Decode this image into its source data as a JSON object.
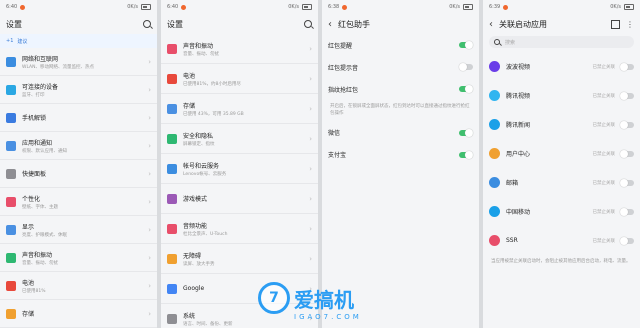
{
  "watermark": {
    "logo_char": "7",
    "text": "爱搞机",
    "url": "IGAO7.COM"
  },
  "panel1": {
    "time": "6:40",
    "net": "0K/s",
    "title": "设置",
    "suggestion": "建议",
    "items": [
      {
        "title": "网络和互联网",
        "sub": "WLAN、移动网络、流量监控、热点",
        "color": "#3b8de0"
      },
      {
        "title": "可连接的设备",
        "sub": "蓝牙、打印",
        "color": "#2aa7e3"
      },
      {
        "title": "手机解锁",
        "sub": "",
        "color": "#3a7be0"
      },
      {
        "title": "应用和通知",
        "sub": "权限、默认应用、通知",
        "color": "#4a90e2"
      },
      {
        "title": "快捷面板",
        "sub": "",
        "color": "#8e8e93"
      },
      {
        "title": "个性化",
        "sub": "壁纸、字体、主题",
        "color": "#e84e6a"
      },
      {
        "title": "显示",
        "sub": "亮度、护眼模式、休眠",
        "color": "#4a90e2"
      },
      {
        "title": "声音和振动",
        "sub": "音量、振动、勿扰",
        "color": "#2eb872"
      },
      {
        "title": "电池",
        "sub": "已使用81%",
        "color": "#e8493c"
      },
      {
        "title": "存储",
        "sub": "",
        "color": "#f0a030"
      }
    ]
  },
  "panel2": {
    "time": "6:40",
    "net": "0K/s",
    "title": "设置",
    "items": [
      {
        "title": "声音和振动",
        "sub": "音量、振动、勿扰",
        "color": "#e84e6a"
      },
      {
        "title": "电池",
        "sub": "已使用81%，约8小时后用尽",
        "color": "#e8493c"
      },
      {
        "title": "存储",
        "sub": "已使用 43%，可用 35.89 GB",
        "color": "#4a90e2"
      },
      {
        "title": "安全和隐私",
        "sub": "屏幕锁定、指纹",
        "color": "#2eb872"
      },
      {
        "title": "帐号和云服务",
        "sub": "Lenovo帐号、云服务",
        "color": "#3b8de0"
      },
      {
        "title": "游戏模式",
        "sub": "",
        "color": "#9b59b6"
      },
      {
        "title": "音频功能",
        "sub": "杜比全景声、U-Touch",
        "color": "#e84e6a"
      },
      {
        "title": "无障碍",
        "sub": "读屏、放大手势",
        "color": "#f0a030"
      },
      {
        "title": "Google",
        "sub": "",
        "color": "#4285f4"
      },
      {
        "title": "系统",
        "sub": "语言、时间、备份、更新",
        "color": "#8e8e93"
      }
    ]
  },
  "panel3": {
    "time": "6:38",
    "net": "0K/s",
    "title": "红包助手",
    "items": [
      {
        "title": "红包提醒",
        "on": true
      },
      {
        "title": "红包提示音",
        "on": false
      },
      {
        "title": "指纹抢红包",
        "on": true
      }
    ],
    "note": "开启后，在锁屏或全面屏状态，红包到达时可以直接通过指纹进行抢红包操作",
    "apps": [
      {
        "title": "微信",
        "on": true
      },
      {
        "title": "支付宝",
        "on": true
      }
    ]
  },
  "panel4": {
    "time": "6:39",
    "net": "0K/s",
    "title": "关联启动应用",
    "search_placeholder": "搜索",
    "apps": [
      {
        "title": "波波视频",
        "status": "已禁止关联",
        "color": "#6a3de8"
      },
      {
        "title": "腾讯视频",
        "status": "已禁止关联",
        "color": "#31b5f0"
      },
      {
        "title": "腾讯新闻",
        "status": "已禁止关联",
        "color": "#1aa0e8"
      },
      {
        "title": "用户中心",
        "status": "已禁止关联",
        "color": "#f0a030"
      },
      {
        "title": "邮箱",
        "status": "已禁止关联",
        "color": "#3b8de0"
      },
      {
        "title": "中国移动",
        "status": "已禁止关联",
        "color": "#1aa0e8"
      },
      {
        "title": "SSR",
        "status": "已禁止关联",
        "color": "#e84e6a"
      }
    ],
    "note": "当应用被禁止关联启动时，会阻止被其他应用后台启动，耗电、流量。"
  }
}
